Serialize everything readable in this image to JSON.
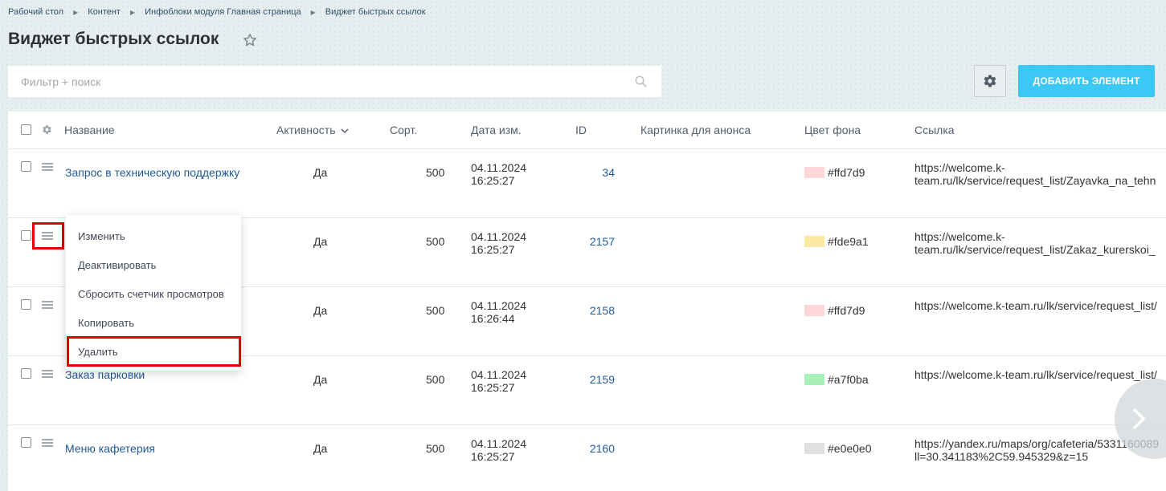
{
  "breadcrumb": [
    "Рабочий стол",
    "Контент",
    "Инфоблоки модуля Главная страница",
    "Виджет быстрых ссылок"
  ],
  "title": "Виджет быстрых ссылок",
  "search": {
    "placeholder": "Фильтр + поиск"
  },
  "add_button": "ДОБАВИТЬ ЭЛЕМЕНТ",
  "columns": [
    "Название",
    "Активность",
    "Сорт.",
    "Дата изм.",
    "ID",
    "Картинка для анонса",
    "Цвет фона",
    "Ссылка"
  ],
  "rows": [
    {
      "name": "Запрос в техническую поддержку",
      "active": "Да",
      "sort": "500",
      "date": "04.11.2024",
      "time": "16:25:27",
      "id": "34",
      "color_text": "#ffd7d9",
      "color": "#ffd7d9",
      "link1": "https://welcome.k-",
      "link2": "team.ru/lk/service/request_list/Zayavka_na_tehn"
    },
    {
      "name": "",
      "active": "Да",
      "sort": "500",
      "date": "04.11.2024",
      "time": "16:25:27",
      "id": "2157",
      "color_text": "#fde9a1",
      "color": "#fde9a1",
      "link1": "https://welcome.k-",
      "link2": "team.ru/lk/service/request_list/Zakaz_kurerskoi_"
    },
    {
      "name": "",
      "active": "Да",
      "sort": "500",
      "date": "04.11.2024",
      "time": "16:26:44",
      "id": "2158",
      "color_text": "#ffd7d9",
      "color": "#ffd7d9",
      "link1": "https://welcome.k-team.ru/lk/service/request_list/",
      "link2": ""
    },
    {
      "name": "Заказ парковки",
      "active": "Да",
      "sort": "500",
      "date": "04.11.2024",
      "time": "16:25:27",
      "id": "2159",
      "color_text": "#a7f0ba",
      "color": "#a7f0ba",
      "link1": "https://welcome.k-team.ru/lk/service/request_list/",
      "link2": ""
    },
    {
      "name": "Меню кафетерия",
      "active": "Да",
      "sort": "500",
      "date": "04.11.2024",
      "time": "16:25:27",
      "id": "2160",
      "color_text": "#e0e0e0",
      "color": "#e0e0e0",
      "link1": "https://yandex.ru/maps/org/cafeteria/5331160089",
      "link2": "ll=30.341183%2C59.945329&z=15"
    }
  ],
  "context_menu": [
    "Изменить",
    "Деактивировать",
    "Сбросить счетчик просмотров",
    "Копировать",
    "Удалить"
  ]
}
